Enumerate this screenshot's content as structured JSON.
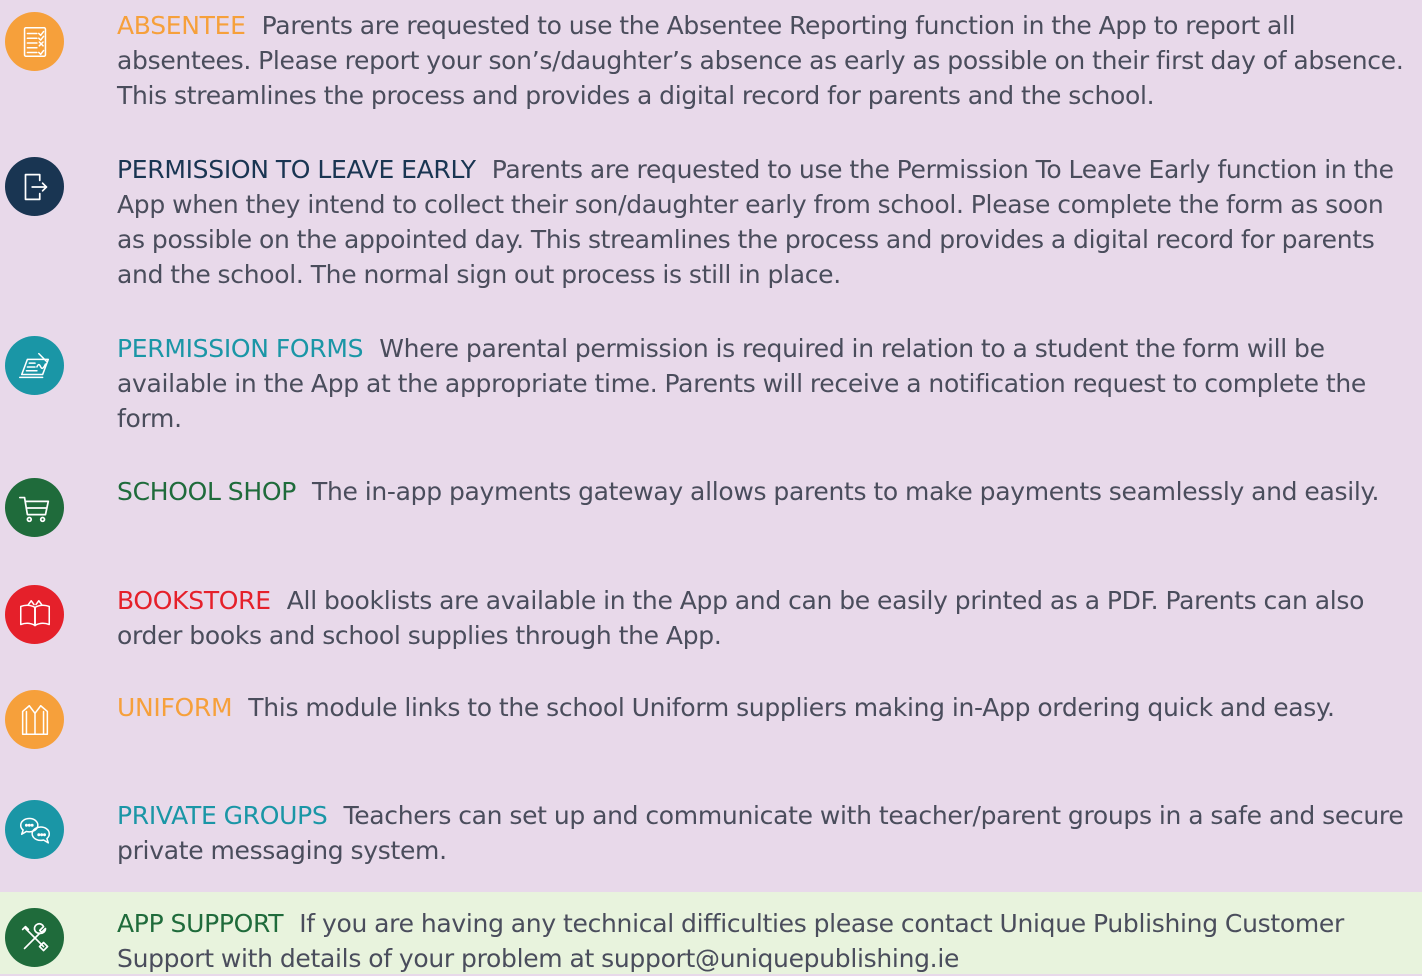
{
  "items": [
    {
      "title": "ABSENTEE",
      "body": "Parents are requested to use the Absentee Reporting function in the App to report all absentees.  Please report your son’s/daughter’s absence as early as possible on their first day of absence.  This streamlines the process and provides a digital record for parents and the school.",
      "icon": "checklist-icon",
      "color": "#f6a03b"
    },
    {
      "title": "PERMISSION TO LEAVE EARLY",
      "body": "Parents are requested to use the Permission To Leave Early function in the App when they intend to collect their son/daughter early from school.  Please complete the form as soon as possible on the appointed day.  This streamlines the process and provides a digital record for parents and the school.  The normal sign out process is still in place.",
      "icon": "exit-door-icon",
      "color": "#193552"
    },
    {
      "title": "PERMISSION FORMS",
      "body": "Where parental permission is required in relation to a student the form will be available in the App at the appropriate time.  Parents will receive a notification request to complete the form.",
      "icon": "signature-form-icon",
      "color": "#1a96a6"
    },
    {
      "title": "SCHOOL SHOP",
      "body": "The in-app payments gateway allows parents to make payments seamlessly and easily.",
      "icon": "shopping-cart-icon",
      "color": "#1f6b3b"
    },
    {
      "title": "BOOKSTORE",
      "body": "All booklists are available in the App and can be easily printed as a PDF.  Parents can also order books and school supplies through the App.",
      "icon": "open-book-icon",
      "color": "#e5202a"
    },
    {
      "title": "UNIFORM",
      "body": "This module links to the school Uniform suppliers making in-App ordering quick and easy.",
      "icon": "shirt-icon",
      "color": "#f6a03b"
    },
    {
      "title": "PRIVATE GROUPS",
      "body": "Teachers can set up and communicate with teacher/parent groups in a safe and secure private messaging system.",
      "icon": "chat-bubbles-icon",
      "color": "#1a96a6"
    },
    {
      "title": "APP SUPPORT",
      "body": "If you are having any technical difficulties please contact Unique Publishing Customer Support with details of your problem at support@uniquepublishing.ie",
      "icon": "tools-icon",
      "color": "#1f6b3b"
    }
  ],
  "colors": {
    "background": "#e8d9ea",
    "support_background": "#e8f3dd",
    "body_text": "#4a4d5c"
  }
}
